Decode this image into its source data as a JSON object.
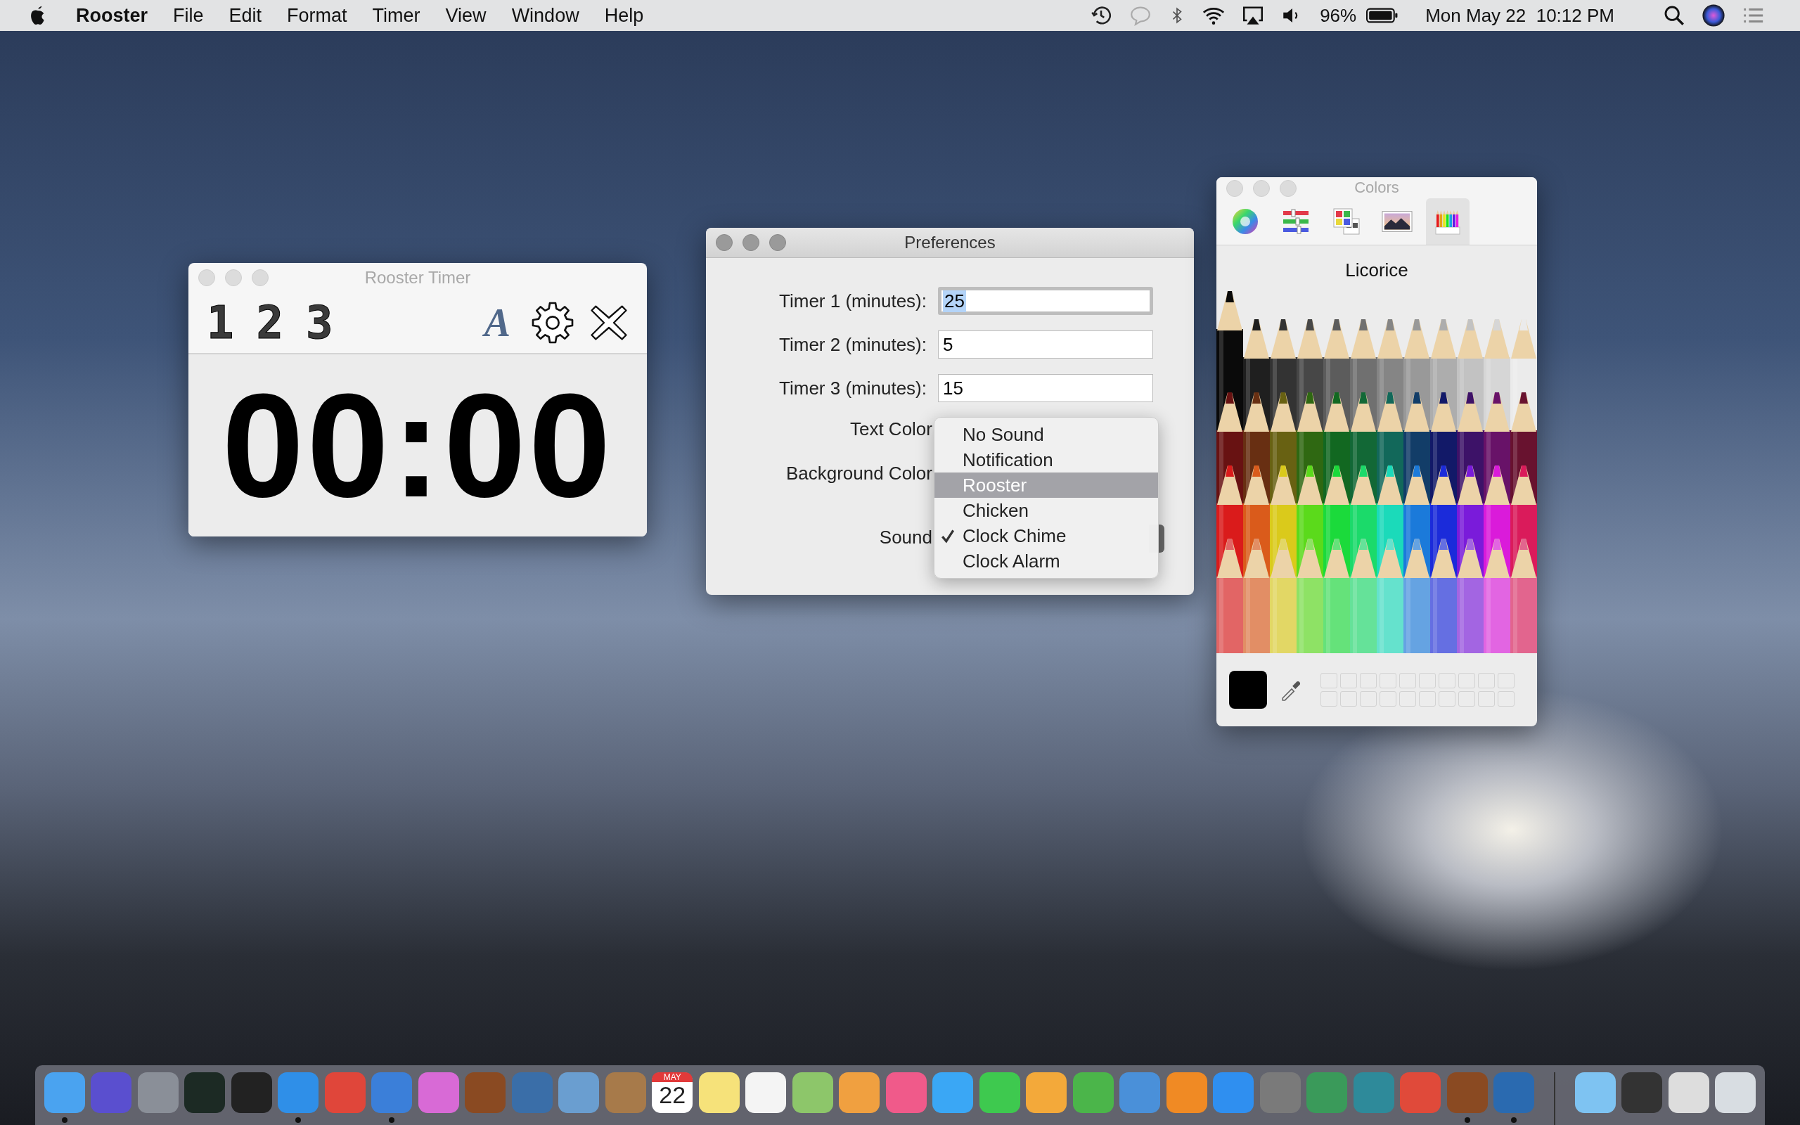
{
  "menu_bar": {
    "app_name": "Rooster",
    "menus": [
      "File",
      "Edit",
      "Format",
      "Timer",
      "View",
      "Window",
      "Help"
    ],
    "battery_percent": "96%",
    "clock": "Mon May 22  10:12 PM"
  },
  "timer_window": {
    "title": "Rooster Timer",
    "timer_buttons": [
      "1",
      "2",
      "3"
    ],
    "font_button": "A",
    "display": "00:00"
  },
  "preferences_window": {
    "title": "Preferences",
    "fields": [
      {
        "label": "Timer 1 (minutes):",
        "value": "25",
        "focused": true
      },
      {
        "label": "Timer 2 (minutes):",
        "value": "5",
        "focused": false
      },
      {
        "label": "Timer 3 (minutes):",
        "value": "15",
        "focused": false
      }
    ],
    "color_labels": [
      "Text Color",
      "Background Color"
    ],
    "sound_label": "Sound",
    "sound_menu": [
      {
        "label": "No Sound",
        "selected": false,
        "checked": false
      },
      {
        "label": "Notification",
        "selected": false,
        "checked": false
      },
      {
        "label": "Rooster",
        "selected": true,
        "checked": false
      },
      {
        "label": "Chicken",
        "selected": false,
        "checked": false
      },
      {
        "label": "Clock Chime",
        "selected": false,
        "checked": true
      },
      {
        "label": "Clock Alarm",
        "selected": false,
        "checked": false
      }
    ]
  },
  "colors_window": {
    "title": "Colors",
    "tabs": [
      {
        "kind": "wheel",
        "selected": false
      },
      {
        "kind": "sliders",
        "selected": false
      },
      {
        "kind": "palettes",
        "selected": false
      },
      {
        "kind": "image",
        "selected": false
      },
      {
        "kind": "pencils",
        "selected": true
      }
    ],
    "color_name": "Licorice"
  },
  "dock": {
    "items": [
      {
        "kind": "app",
        "color": "#4aa3f0",
        "running": true
      },
      {
        "kind": "app",
        "color": "#5a4fcf",
        "running": false
      },
      {
        "kind": "app",
        "color": "#8a8f98",
        "running": false
      },
      {
        "kind": "app",
        "color": "#1c2a24",
        "running": false
      },
      {
        "kind": "app",
        "color": "#222222",
        "running": false
      },
      {
        "kind": "app",
        "color": "#2f8fe8",
        "running": true
      },
      {
        "kind": "app",
        "color": "#e0463a",
        "running": false
      },
      {
        "kind": "app",
        "color": "#3b7fd9",
        "running": true
      },
      {
        "kind": "app",
        "color": "#d86ad6",
        "running": false
      },
      {
        "kind": "app",
        "color": "#8a4a22",
        "running": false
      },
      {
        "kind": "app",
        "color": "#3a6ea8",
        "running": false
      },
      {
        "kind": "app",
        "color": "#6a9ed0",
        "running": false
      },
      {
        "kind": "app",
        "color": "#a77a4a",
        "running": false
      },
      {
        "kind": "calendar",
        "month": "MAY",
        "day": "22",
        "running": false
      },
      {
        "kind": "app",
        "color": "#f6e27a",
        "running": false
      },
      {
        "kind": "app",
        "color": "#f4f4f4",
        "running": false
      },
      {
        "kind": "app",
        "color": "#8dc66a",
        "running": false
      },
      {
        "kind": "app",
        "color": "#f0a040",
        "running": false
      },
      {
        "kind": "app",
        "color": "#f05a8a",
        "running": false
      },
      {
        "kind": "app",
        "color": "#3aa7f5",
        "running": false
      },
      {
        "kind": "app",
        "color": "#3ec94f",
        "running": false
      },
      {
        "kind": "app",
        "color": "#f3a93a",
        "running": false
      },
      {
        "kind": "app",
        "color": "#4bb54a",
        "running": false
      },
      {
        "kind": "app",
        "color": "#4a90d9",
        "running": false
      },
      {
        "kind": "app",
        "color": "#f08a24",
        "running": false
      },
      {
        "kind": "app",
        "color": "#2f8ff0",
        "running": false
      },
      {
        "kind": "app",
        "color": "#7a7a7a",
        "running": false
      },
      {
        "kind": "app",
        "color": "#3a9a5a",
        "running": false
      },
      {
        "kind": "app",
        "color": "#2e8a9a",
        "running": false
      },
      {
        "kind": "app",
        "color": "#e04a3a",
        "running": false
      },
      {
        "kind": "app",
        "color": "#8a4a22",
        "running": true
      },
      {
        "kind": "app",
        "color": "#2a6ab0",
        "running": true
      },
      {
        "kind": "separator"
      },
      {
        "kind": "app",
        "color": "#7ec3f2",
        "running": false
      },
      {
        "kind": "app",
        "color": "#333333",
        "running": false
      },
      {
        "kind": "app",
        "color": "#dddddd",
        "running": false
      },
      {
        "kind": "app",
        "color": "#d8dde2",
        "running": false
      }
    ]
  }
}
